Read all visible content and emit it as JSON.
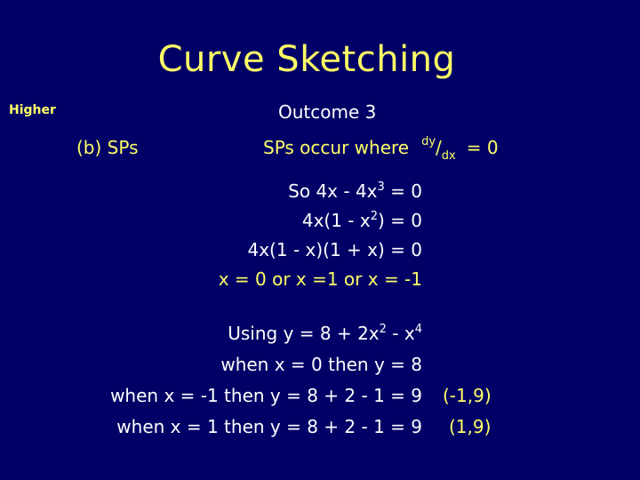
{
  "slide": {
    "title": "Curve Sketching",
    "level_label": "Higher",
    "outcome": "Outcome 3",
    "section": "(b)  SPs",
    "sp_condition": {
      "text": "SPs occur  where",
      "frac_num": "dy",
      "frac_slash": "/",
      "frac_den": "dx",
      "rhs": "=  0"
    },
    "working": {
      "line1": {
        "prefix": "So  4x - 4x",
        "sup": "3",
        "suffix": " = 0"
      },
      "line2": {
        "prefix": "4x(1 - x",
        "sup": "2",
        "suffix": ") = 0"
      },
      "line3": "4x(1 - x)(1 + x) = 0",
      "solutions": "x = 0  or  x =1  or  x = -1"
    },
    "substitution": {
      "using": {
        "prefix": "Using   y = 8 + 2x",
        "sup1": "2",
        "mid": " - x",
        "sup2": "4"
      },
      "when0": "when  x = 0  then  y = 8",
      "whenm1": "when  x = -1  then  y = 8 + 2 - 1 = 9",
      "when1": "when  x = 1   then  y = 8 + 2 - 1 = 9",
      "point_m1": "(-1,9)",
      "point_1": "(1,9)"
    },
    "colors": {
      "background": "#000066",
      "yellow": "#ffff66",
      "white": "#ffffff"
    }
  }
}
